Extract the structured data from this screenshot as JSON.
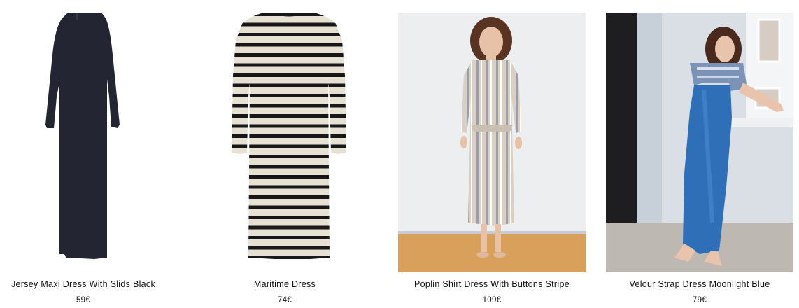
{
  "products": [
    {
      "name": "Jersey Maxi Dress With Slids Black",
      "price": "59€",
      "image": "black-maxi-dress-icon"
    },
    {
      "name": "Maritime Dress",
      "price": "74€",
      "image": "striped-dress-icon"
    },
    {
      "name": "Poplin Shirt Dress With Buttons Stripe",
      "price": "109€",
      "image": "model-striped-shirt-dress-icon"
    },
    {
      "name": "Velour Strap Dress Moonlight Blue",
      "price": "79€",
      "image": "model-blue-strap-dress-icon"
    }
  ]
}
